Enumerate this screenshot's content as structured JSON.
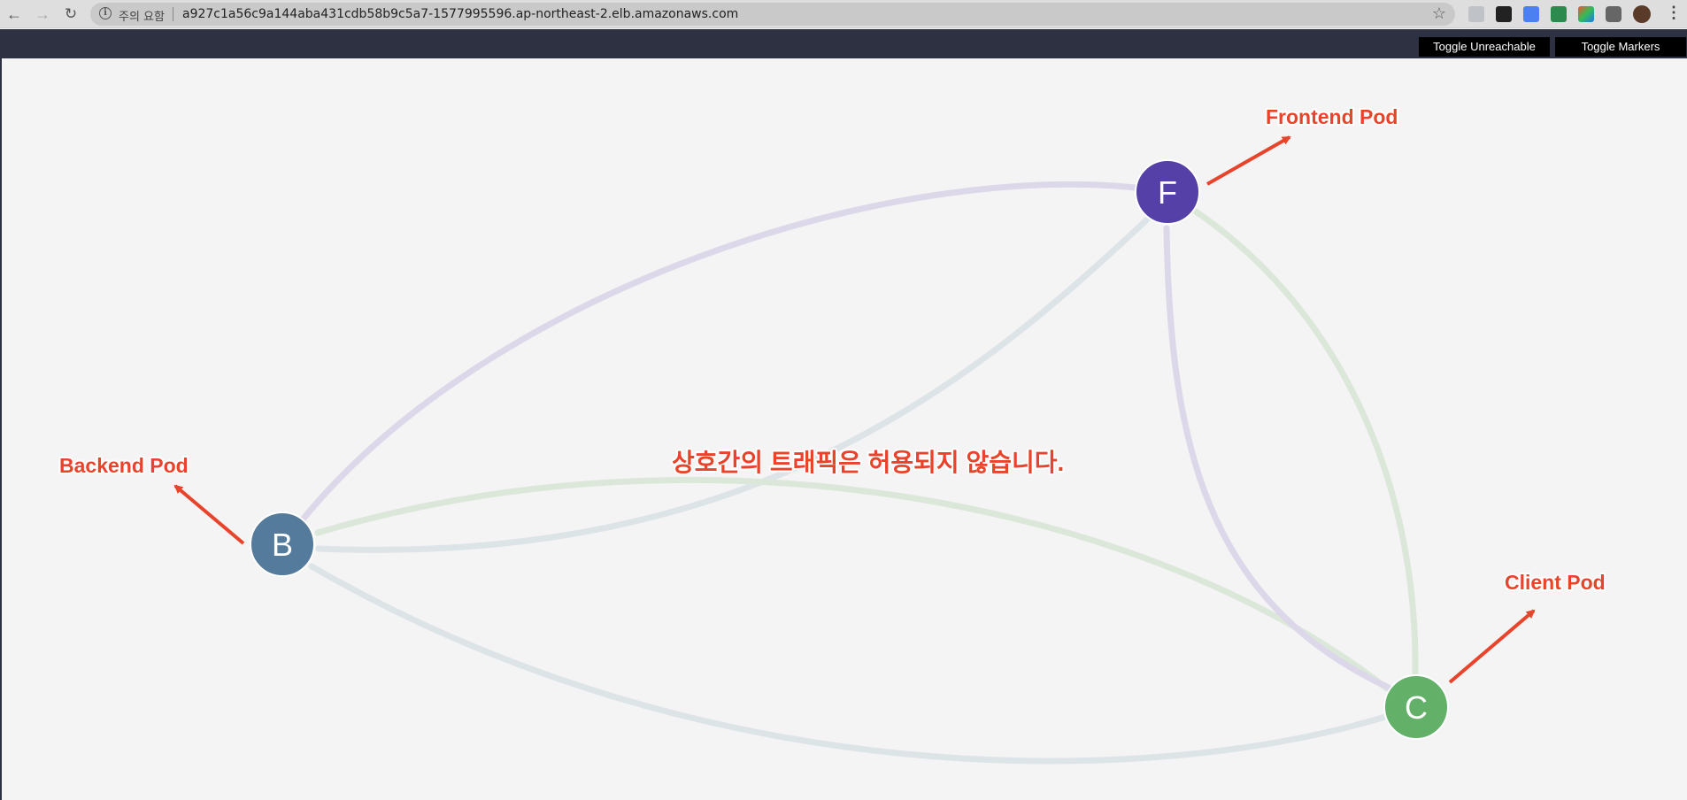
{
  "browser": {
    "security_label": "주의 요함",
    "url": "a927c1a56c9a144aba431cdb58b9c5a7-1577995596.ap-northeast-2.elb.amazonaws.com"
  },
  "toolbar": {
    "toggle_unreachable": "Toggle Unreachable",
    "toggle_markers": "Toggle Markers"
  },
  "graph": {
    "nodes": {
      "frontend": {
        "letter": "F",
        "color": "#5540a8"
      },
      "backend": {
        "letter": "B",
        "color": "#557b9c"
      },
      "client": {
        "letter": "C",
        "color": "#63b169"
      }
    },
    "edge_colors": {
      "frontend": "#dcd8ea",
      "backend": "#dde4e8",
      "client": "#dbe8d9"
    }
  },
  "annotations": {
    "frontend_pod": "Frontend Pod",
    "backend_pod": "Backend Pod",
    "client_pod": "Client Pod",
    "message": "상호간의 트래픽은 허용되지 않습니다."
  },
  "annotation_color": "#e8442c"
}
